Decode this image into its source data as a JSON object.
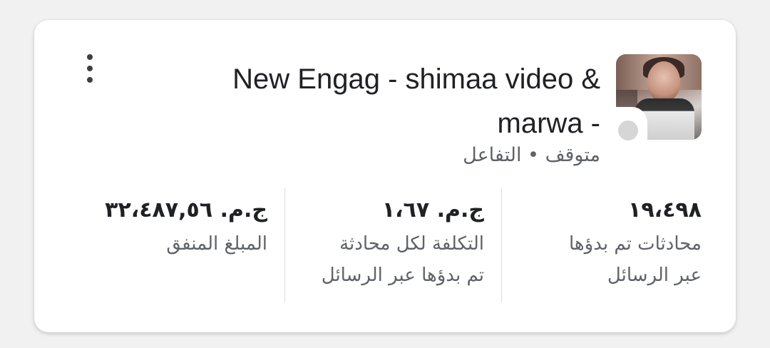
{
  "campaign": {
    "title_line1": "New Engag - shimaa video &",
    "title_line2": "marwa -",
    "status": "متوقف",
    "separator": "•",
    "objective": "التفاعل"
  },
  "metrics": [
    {
      "value": "١٩،٤٩٨",
      "label_line1": "محادثات تم بدؤها",
      "label_line2": "عبر الرسائل"
    },
    {
      "value": "ج.م. ١،٦٧",
      "label_line1": "التكلفة لكل محادثة",
      "label_line2": "تم بدؤها عبر الرسائل"
    },
    {
      "value": "ج.م. ٣٢،٤٨٧,٥٦",
      "label_line1": "المبلغ المنفق",
      "label_line2": ""
    }
  ],
  "icons": {
    "menu": "more-vertical-icon",
    "status": "status-dot-icon"
  },
  "colors": {
    "background": "#f1f1f1",
    "card": "#ffffff",
    "text_primary": "#202124",
    "text_secondary": "#5f6368",
    "divider": "#dadce0",
    "status_inactive": "#d6d6d6"
  }
}
